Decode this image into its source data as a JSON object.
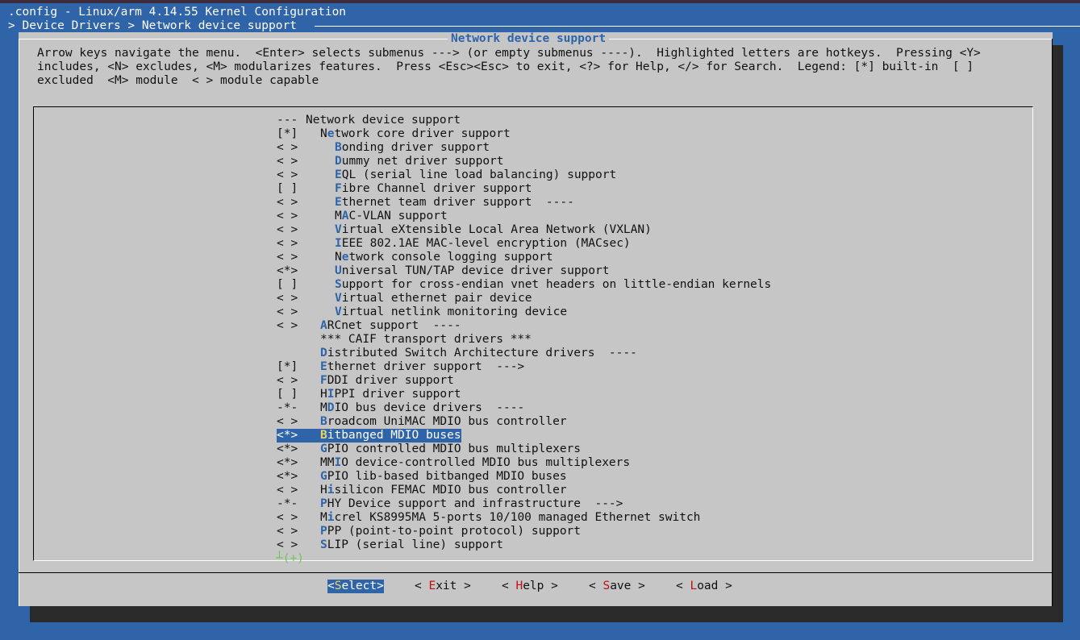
{
  "window": {
    "title": ".config - Linux/arm 4.14.55 Kernel Configuration",
    "breadcrumb": "> Device Drivers > Network device support"
  },
  "dialog": {
    "title": "Network device support",
    "help_lines": [
      "Arrow keys navigate the menu.  <Enter> selects submenus ---> (or empty submenus ----).  Highlighted letters are hotkeys.  Pressing <Y>",
      "includes, <N> excludes, <M> modularizes features.  Press <Esc><Esc> to exit, <?> for Help, </> for Search.  Legend: [*] built-in  [ ]",
      "excluded  <M> module  < > module capable"
    ]
  },
  "menu": {
    "items": [
      {
        "state": "---",
        "pre": "",
        "hot": "",
        "rest": "Network device support",
        "indent": 0
      },
      {
        "state": "[*]",
        "pre": "N",
        "hot": "e",
        "rest": "twork core driver support",
        "indent": 1
      },
      {
        "state": "< >",
        "pre": "",
        "hot": "B",
        "rest": "onding driver support",
        "indent": 2
      },
      {
        "state": "< >",
        "pre": "",
        "hot": "D",
        "rest": "ummy net driver support",
        "indent": 2
      },
      {
        "state": "< >",
        "pre": "",
        "hot": "E",
        "rest": "QL (serial line load balancing) support",
        "indent": 2
      },
      {
        "state": "[ ]",
        "pre": "",
        "hot": "F",
        "rest": "ibre Channel driver support",
        "indent": 2
      },
      {
        "state": "< >",
        "pre": "",
        "hot": "E",
        "rest": "thernet team driver support  ----",
        "indent": 2
      },
      {
        "state": "< >",
        "pre": "M",
        "hot": "A",
        "rest": "C-VLAN support",
        "indent": 2
      },
      {
        "state": "< >",
        "pre": "",
        "hot": "V",
        "rest": "irtual eXtensible Local Area Network (VXLAN)",
        "indent": 2
      },
      {
        "state": "< >",
        "pre": "",
        "hot": "I",
        "rest": "EEE 802.1AE MAC-level encryption (MACsec)",
        "indent": 2
      },
      {
        "state": "< >",
        "pre": "N",
        "hot": "e",
        "rest": "twork console logging support",
        "indent": 2
      },
      {
        "state": "<*>",
        "pre": "",
        "hot": "U",
        "rest": "niversal TUN/TAP device driver support",
        "indent": 2
      },
      {
        "state": "[ ]",
        "pre": "",
        "hot": "S",
        "rest": "upport for cross-endian vnet headers on little-endian kernels",
        "indent": 2
      },
      {
        "state": "< >",
        "pre": "",
        "hot": "V",
        "rest": "irtual ethernet pair device",
        "indent": 2
      },
      {
        "state": "< >",
        "pre": "",
        "hot": "V",
        "rest": "irtual netlink monitoring device",
        "indent": 2
      },
      {
        "state": "< >",
        "pre": "",
        "hot": "A",
        "rest": "RCnet support  ----",
        "indent": 1
      },
      {
        "state": "",
        "pre": "*** CAIF transport drivers ***",
        "hot": "",
        "rest": "",
        "indent": 1
      },
      {
        "state": "",
        "pre": "",
        "hot": "D",
        "rest": "istributed Switch Architecture drivers  ----",
        "indent": 1
      },
      {
        "state": "[*]",
        "pre": "",
        "hot": "E",
        "rest": "thernet driver support  --->",
        "indent": 1
      },
      {
        "state": "< >",
        "pre": "",
        "hot": "F",
        "rest": "DDI driver support",
        "indent": 1
      },
      {
        "state": "[ ]",
        "pre": "H",
        "hot": "I",
        "rest": "PPI driver support",
        "indent": 1
      },
      {
        "state": "-*-",
        "pre": "M",
        "hot": "D",
        "rest": "IO bus device drivers  ----",
        "indent": 1
      },
      {
        "state": "< >",
        "pre": "",
        "hot": "B",
        "rest": "roadcom UniMAC MDIO bus controller",
        "indent": 1
      },
      {
        "state": "<*>",
        "pre": "",
        "hot": "B",
        "rest": "itbanged MDIO buses",
        "indent": 1,
        "selected": true
      },
      {
        "state": "<*>",
        "pre": "",
        "hot": "G",
        "rest": "PIO controlled MDIO bus multiplexers",
        "indent": 1
      },
      {
        "state": "<*>",
        "pre": "MM",
        "hot": "I",
        "rest": "O device-controlled MDIO bus multiplexers",
        "indent": 1
      },
      {
        "state": "<*>",
        "pre": "",
        "hot": "G",
        "rest": "PIO lib-based bitbanged MDIO buses",
        "indent": 1
      },
      {
        "state": "< >",
        "pre": "H",
        "hot": "i",
        "rest": "silicon FEMAC MDIO bus controller",
        "indent": 1
      },
      {
        "state": "-*-",
        "pre": "",
        "hot": "P",
        "rest": "HY Device support and infrastructure  --->",
        "indent": 1
      },
      {
        "state": "< >",
        "pre": "M",
        "hot": "i",
        "rest": "crel KS8995MA 5-ports 10/100 managed Ethernet switch",
        "indent": 1
      },
      {
        "state": "< >",
        "pre": "",
        "hot": "P",
        "rest": "PP (point-to-point protocol) support",
        "indent": 1
      },
      {
        "state": "< >",
        "pre": "",
        "hot": "S",
        "rest": "LIP (serial line) support",
        "indent": 1
      }
    ],
    "more_indicator": "┴(+)"
  },
  "buttons": [
    {
      "pre": "<",
      "hot": "S",
      "rest": "elect>",
      "active": true
    },
    {
      "pre": "< ",
      "hot": "E",
      "rest": "xit >",
      "active": false
    },
    {
      "pre": "< ",
      "hot": "H",
      "rest": "elp >",
      "active": false
    },
    {
      "pre": "< ",
      "hot": "S",
      "rest": "ave >",
      "active": false
    },
    {
      "pre": "< ",
      "hot": "L",
      "rest": "oad >",
      "active": false
    }
  ],
  "colors": {
    "background": "#2f64a8",
    "dialog": "#c6c6c6",
    "hotkey": "#2f64a8",
    "button_hotkey": "#c01010",
    "more": "#6ec84e"
  }
}
